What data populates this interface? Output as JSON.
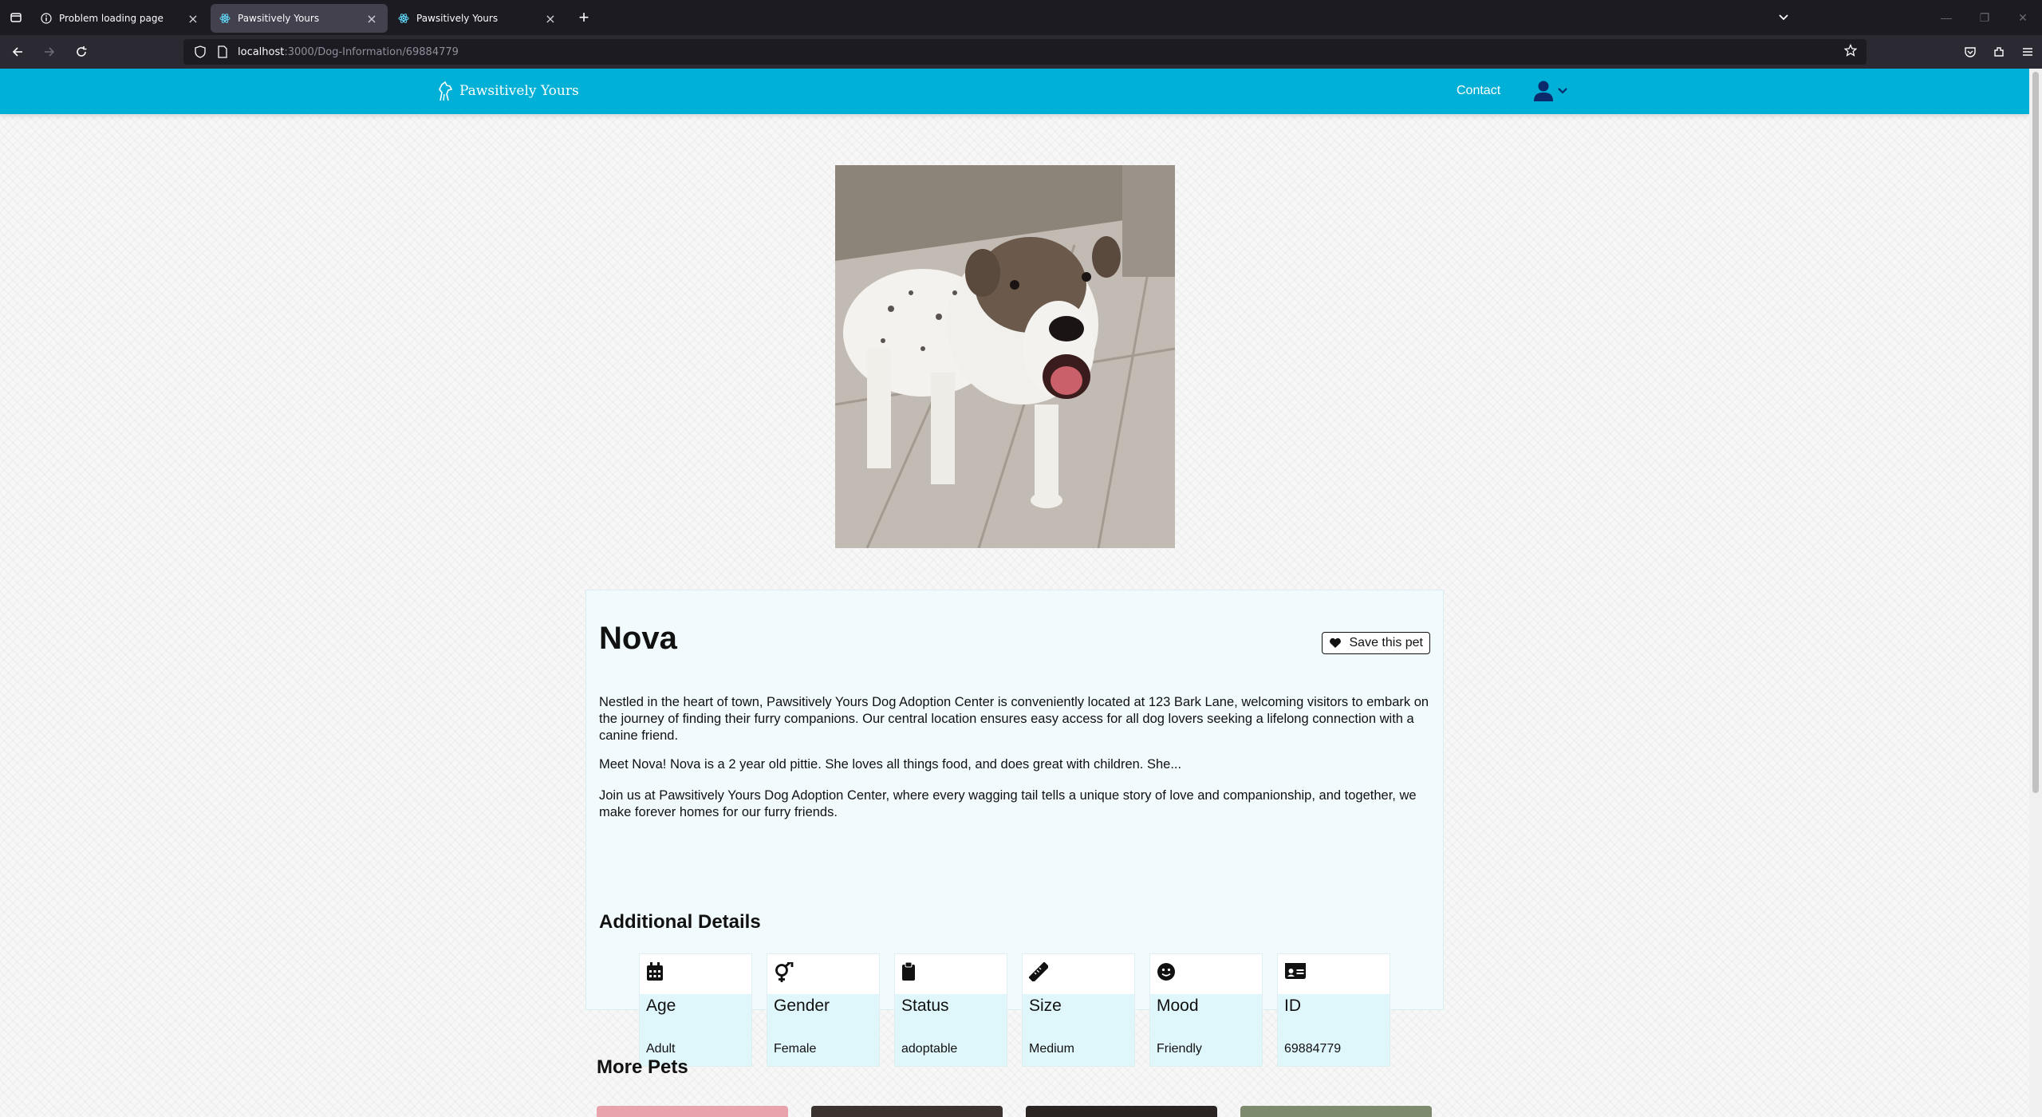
{
  "browser": {
    "tabs": [
      {
        "title": "Problem loading page",
        "icon": "info-icon",
        "active": false
      },
      {
        "title": "Pawsitively Yours",
        "icon": "react-icon",
        "active": true
      },
      {
        "title": "Pawsitively Yours",
        "icon": "react-icon",
        "active": false
      }
    ],
    "url_host": "localhost",
    "url_path": ":3000/Dog-Information/69884779"
  },
  "site": {
    "brand": "Pawsitively Yours",
    "nav_contact": "Contact"
  },
  "dog": {
    "name": "Nova",
    "save_label": "Save this pet",
    "paragraphs": [
      "Nestled in the heart of town, Pawsitively Yours Dog Adoption Center is conveniently located at 123 Bark Lane, welcoming visitors to embark on the journey of finding their furry companions. Our central location ensures easy access for all dog lovers seeking a lifelong connection with a canine friend.",
      "Meet Nova! Nova is a 2 year old pittie. She loves all things food, and does great with children. She...",
      "Join us at Pawsitively Yours Dog Adoption Center, where every wagging tail tells a unique story of love and companionship, and together, we make forever homes for our furry friends."
    ],
    "details_title": "Additional Details",
    "details": [
      {
        "label": "Age",
        "value": "Adult",
        "icon": "calendar-icon"
      },
      {
        "label": "Gender",
        "value": "Female",
        "icon": "gender-icon"
      },
      {
        "label": "Status",
        "value": "adoptable",
        "icon": "clipboard-icon"
      },
      {
        "label": "Size",
        "value": "Medium",
        "icon": "ruler-icon"
      },
      {
        "label": "Mood",
        "value": "Friendly",
        "icon": "smile-icon"
      },
      {
        "label": "ID",
        "value": "69884779",
        "icon": "id-card-icon"
      }
    ]
  },
  "more_pets": {
    "title": "More Pets"
  },
  "colors": {
    "header": "#00b0d6",
    "card": "#f1fbfe",
    "detail": "#dff6fb"
  }
}
